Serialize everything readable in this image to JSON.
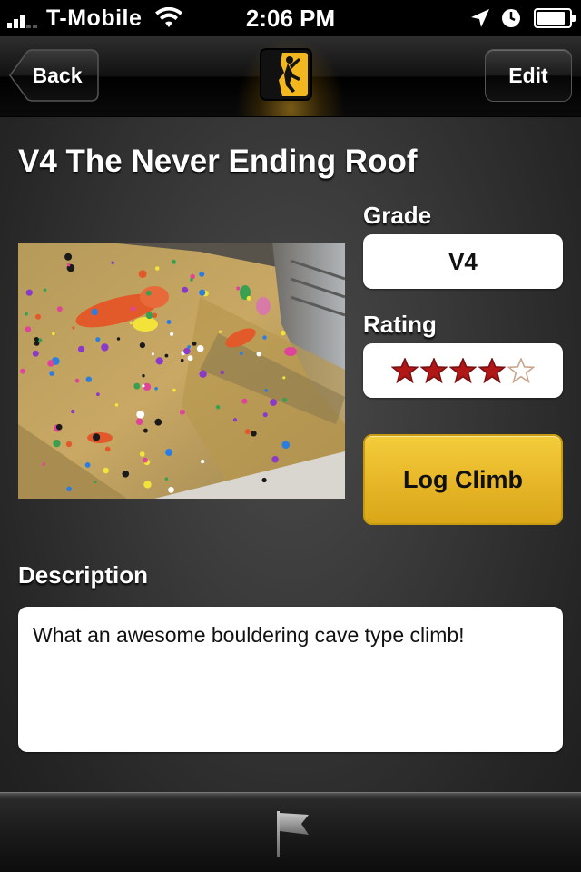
{
  "status_bar": {
    "carrier": "T-Mobile",
    "time": "2:06 PM",
    "signal_bars": 5,
    "signal_bars_active": 3,
    "battery_level": 0.9,
    "icons": [
      "signal-icon",
      "wifi-icon",
      "location-icon",
      "alarm-icon",
      "battery-icon"
    ]
  },
  "nav": {
    "back_label": "Back",
    "edit_label": "Edit",
    "logo_icon": "climber-logo-icon"
  },
  "climb": {
    "title": "V4 The Never Ending Roof",
    "grade_label": "Grade",
    "grade_value": "V4",
    "rating_label": "Rating",
    "rating_value": 4,
    "rating_max": 5,
    "log_button_label": "Log Climb",
    "description_label": "Description",
    "description_text": "What an awesome bouldering cave type climb!"
  },
  "toolbar": {
    "flag_icon": "flag-icon"
  },
  "colors": {
    "accent_yellow": "#e8b82a",
    "star_red": "#b01818",
    "nav_black": "#000000"
  }
}
